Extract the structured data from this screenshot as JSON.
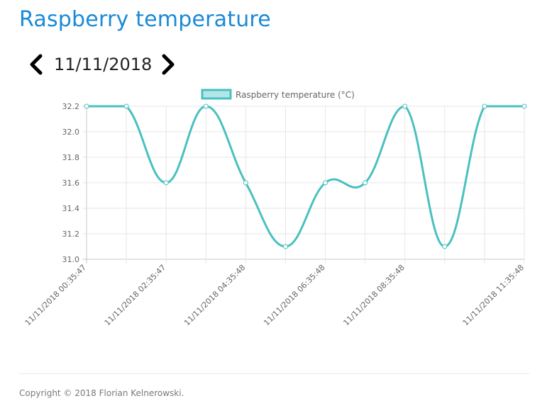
{
  "page": {
    "title": "Raspberry temperature"
  },
  "date_nav": {
    "date": "11/11/2018",
    "prev_icon": "chevron-left-icon",
    "next_icon": "chevron-right-icon"
  },
  "footer": {
    "copyright": "Copyright © 2018 Florian Kelnerowski."
  },
  "chart_data": {
    "type": "line",
    "title": "",
    "xlabel": "",
    "ylabel": "",
    "ylim": [
      31.0,
      32.2
    ],
    "y_ticks": [
      "32.2",
      "32.0",
      "31.8",
      "31.6",
      "31.4",
      "31.2",
      "31.0"
    ],
    "x_tick_labels": [
      "11/11/2018 00:35:47",
      "11/11/2018 02:35:47",
      "11/11/2018 04:35:48",
      "11/11/2018 06:35:48",
      "11/11/2018 08:35:48",
      "11/11/2018 11:35:48"
    ],
    "grid": true,
    "legend": "top-center",
    "series": [
      {
        "name": "Raspberry temperature (°C)",
        "color": "#4bc0c0",
        "fill": "#b3e6e6",
        "values": [
          32.2,
          32.2,
          31.6,
          32.2,
          31.6,
          31.1,
          31.6,
          31.6,
          32.2,
          31.1,
          32.2,
          32.2
        ]
      }
    ]
  }
}
